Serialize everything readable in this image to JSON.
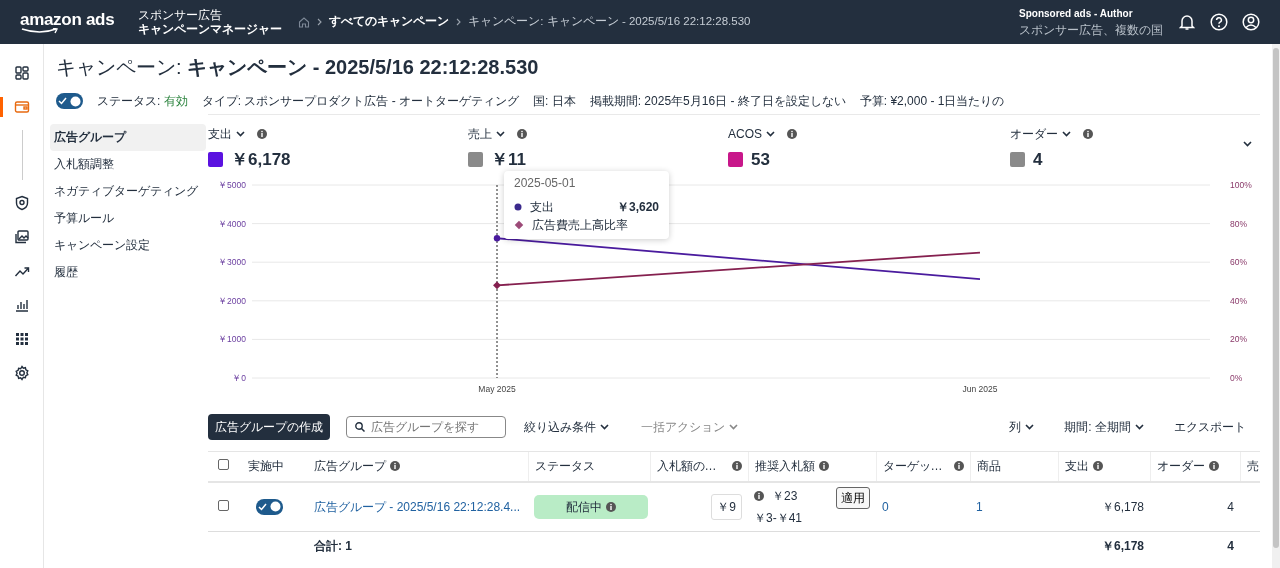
{
  "navbar": {
    "logo": "amazon ads",
    "product": "スポンサー広告",
    "app": "キャンペーンマネージャー",
    "breadcrumbs": [
      "すべてのキャンペーン",
      "キャンペーン: キャンペーン - 2025/5/16 22:12:28.530"
    ],
    "account_name": "Sponsored ads - Author",
    "account_sub": "スポンサー広告、複数の国"
  },
  "rail": [
    {
      "kind": "dashboard",
      "selected": false
    },
    {
      "kind": "wallet",
      "selected": true
    },
    {
      "kind": "divider"
    },
    {
      "kind": "shield",
      "selected": false
    },
    {
      "kind": "images",
      "selected": false
    },
    {
      "kind": "trend",
      "selected": false
    },
    {
      "kind": "bars",
      "selected": false
    },
    {
      "kind": "apps",
      "selected": false
    },
    {
      "kind": "gear",
      "selected": false
    }
  ],
  "page": {
    "title_prefix": "キャンペーン: ",
    "title": "キャンペーン - 2025/5/16 22:12:28.530"
  },
  "meta": {
    "enabled": true,
    "items": [
      {
        "label": "ステータス: ",
        "value": "有効",
        "kind": "status"
      },
      {
        "label": "タイプ: ",
        "value": "スポンサープロダクト広告 - オートターゲティング",
        "kind": "plain"
      },
      {
        "label": "国: ",
        "value": "日本",
        "kind": "plain"
      },
      {
        "label": "掲載期間: ",
        "value": "2025年5月16日 - 終了日を設定しない",
        "kind": "plain"
      },
      {
        "label": "予算: ",
        "value": "¥2,000 - 1日当たりの",
        "kind": "plain"
      }
    ]
  },
  "subnav": [
    {
      "label": "広告グループ",
      "selected": true
    },
    {
      "label": "入札額調整",
      "selected": false
    },
    {
      "label": "ネガティブターゲティング",
      "selected": false
    },
    {
      "label": "予算ルール",
      "selected": false
    },
    {
      "label": "キャンペーン設定",
      "selected": false
    },
    {
      "label": "履歴",
      "selected": false
    }
  ],
  "metrics": [
    {
      "label": "支出",
      "value": "￥6,178",
      "color": "#5b12e0"
    },
    {
      "label": "売上",
      "value": "￥11",
      "color": "#8a8a8a"
    },
    {
      "label": "ACOS",
      "value": "53",
      "color": "#c8178a"
    },
    {
      "label": "オーダー",
      "value": "4",
      "color": "#8a8a8a"
    }
  ],
  "tooltip": {
    "date": "2025-05-01",
    "rows": [
      {
        "value": "￥3,620",
        "kind": "circle",
        "color": "#3b2a8c"
      },
      {
        "kind": "diamond",
        "color": "#9c4a78"
      }
    ]
  },
  "chart_data": {
    "type": "line",
    "grid": true,
    "ref_lines": [
      {
        "axis": "x",
        "value": "May 2025"
      }
    ],
    "categories": [
      "May 2025",
      "Jun 2025"
    ],
    "ylim": [
      0,
      5000
    ],
    "yticks": [
      {
        "value": 0,
        "label": "￥0"
      },
      {
        "value": 1000,
        "label": "￥1000"
      },
      {
        "value": 2000,
        "label": "￥2000"
      },
      {
        "value": 3000,
        "label": "￥3000"
      },
      {
        "value": 4000,
        "label": "￥4000"
      },
      {
        "value": 5000,
        "label": "￥5000"
      }
    ],
    "series": [
      {
        "name": "支出",
        "color": "#4a1b9e",
        "values": [
          3620,
          2560
        ]
      },
      {
        "name": "広告費売上高比率",
        "color": "#85204f",
        "values": [
          48,
          65
        ],
        "axis": "y2"
      }
    ],
    "y2lim": [
      0,
      100
    ],
    "y2ticks": [
      {
        "value": 0,
        "label": "0%"
      },
      {
        "value": 20,
        "label": "20%"
      },
      {
        "value": 40,
        "label": "40%"
      },
      {
        "value": 60,
        "label": "60%"
      },
      {
        "value": 80,
        "label": "80%"
      },
      {
        "value": 100,
        "label": "100%"
      }
    ]
  },
  "toolbar": {
    "create": "広告グループの作成",
    "search_placeholder": "広告グループを探す",
    "filter": "絞り込み条件",
    "bulk": "一括アクション",
    "columns": "列",
    "period": "期間: 全期間",
    "export": "エクスポート"
  },
  "table": {
    "header_checked": false,
    "columns": [
      {
        "label": "実施中",
        "info": false
      },
      {
        "label": "広告グループ",
        "info": true
      },
      {
        "label": "ステータス",
        "info": false
      },
      {
        "label": "入札額の…",
        "info": true
      },
      {
        "label": "推奨入札額",
        "info": true
      },
      {
        "label": "ターゲッ…",
        "info": true
      },
      {
        "label": "商品",
        "info": false
      },
      {
        "label": "支出",
        "info": true
      },
      {
        "label": "オーダー",
        "info": true
      },
      {
        "label": "売"
      }
    ],
    "rows": [
      {
        "checked": false,
        "enabled": true,
        "name": "広告グループ - 2025/5/16 22:12:28.4...",
        "status": "配信中",
        "bid": "￥9",
        "suggested": "￥23",
        "suggested_range": "￥3-￥41",
        "apply": "適用",
        "targets": "0",
        "products": "1",
        "spend": "￥6,178",
        "orders": "4"
      }
    ],
    "total_label": "合計: 1",
    "total_spend": "￥6,178",
    "total_orders": "4"
  }
}
